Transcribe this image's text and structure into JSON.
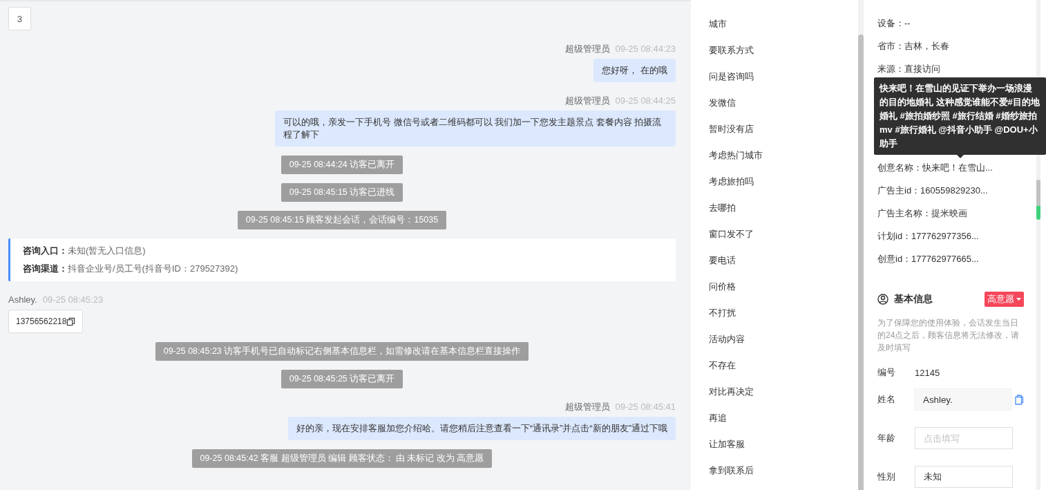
{
  "chat": {
    "page_button": "3",
    "messages": [
      {
        "kind": "agent",
        "sender": "超级管理员",
        "time": "09-25 08:44:23",
        "text": "您好呀， 在的哦"
      },
      {
        "kind": "agent",
        "sender": "超级管理员",
        "time": "09-25 08:44:25",
        "text": "可以的哦，亲发一下手机号 微信号或者二维码都可以 我们加一下您发主题景点 套餐内容 拍摄流程了解下"
      },
      {
        "kind": "system",
        "text": "09-25 08:44:24 访客已离开"
      },
      {
        "kind": "system",
        "text": "09-25 08:45:15 访客已进线"
      },
      {
        "kind": "system",
        "text": "09-25 08:45:15 顾客发起会话，会话编号：15035"
      },
      {
        "kind": "source",
        "rows": [
          {
            "label": "咨询入口：",
            "value": "未知(暂无入口信息)"
          },
          {
            "label": "咨询渠道：",
            "value": "抖音企业号/员工号(抖音号ID：279527392)"
          }
        ]
      },
      {
        "kind": "visitor",
        "sender": "Ashley.",
        "time": "09-25 08:45:23",
        "text": "13756562218"
      },
      {
        "kind": "system",
        "text": "09-25 08:45:23 访客手机号已自动标记右侧基本信息栏，如需修改请在基本信息栏直接操作"
      },
      {
        "kind": "system",
        "text": "09-25 08:45:25 访客已离开"
      },
      {
        "kind": "agent",
        "sender": "超级管理员",
        "time": "09-25 08:45:41",
        "text": "好的亲，现在安排客服加您介绍哈。请您稍后注意查看一下“通讯录”并点击“新的朋友”通过下哦"
      },
      {
        "kind": "system",
        "text": "09-25 08:45:42 客服 超级管理员 编辑 顾客状态： 由 未标记 改为 高意愿"
      }
    ]
  },
  "quick_replies": [
    "城市",
    "要联系方式",
    "问是咨询吗",
    "发微信",
    "暂时没有店",
    "考虑热门城市",
    "考虑旅拍吗",
    "去哪拍",
    "窗口发不了",
    "要电话",
    "问价格",
    "不打扰",
    "活动内容",
    "不存在",
    "对比再决定",
    "再追",
    "让加客服",
    "拿到联系后"
  ],
  "source_info": {
    "rows": [
      "设备：--",
      "省市：吉林，长春",
      "来源：直接访问",
      "创意名称：快来吧！在雪山...",
      "广告主id：160559829230...",
      "广告主名称：提米映画",
      "计划id：177762977356...",
      "创意id：177762977665..."
    ],
    "tooltip": "快来吧！在雪山的见证下举办一场浪漫的目的地婚礼 这种感觉谁能不爱#目的地婚礼 #旅拍婚纱照 #旅行结婚 #婚纱旅拍mv #旅行婚礼 @抖音小助手 @DOU+小助手"
  },
  "basic_info": {
    "title": "基本信息",
    "intent_tag": "高意愿",
    "notice": "为了保障您的使用体验，会话发生当日的24点之后，顾客信息将无法修改，请及时填写",
    "fields": [
      {
        "kind": "text",
        "label": "编号",
        "value": "12145"
      },
      {
        "kind": "input",
        "label": "姓名",
        "value": "Ashley."
      },
      {
        "kind": "empty",
        "label": "年龄",
        "placeholder": "点击填写"
      },
      {
        "kind": "select",
        "label": "性别",
        "value": "未知"
      }
    ]
  }
}
